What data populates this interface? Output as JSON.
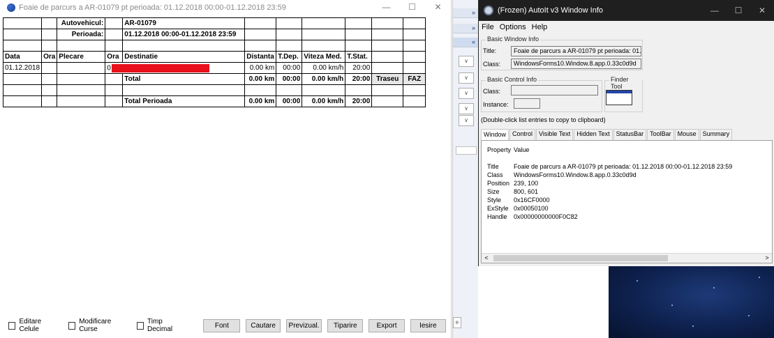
{
  "report_window": {
    "title": "Foaie de parcurs a AR-01079 pt perioada: 01.12.2018 00:00-01.12.2018 23:59",
    "controls": {
      "minimize": "—",
      "maximize": "☐",
      "close": "✕"
    },
    "header": {
      "vehicle_label": "Autovehicul:",
      "vehicle_value": "AR-01079",
      "period_label": "Perioada:",
      "period_value": "01.12.2018 00:00-01.12.2018 23:59"
    },
    "columns": [
      "Data",
      "Ora",
      "Plecare",
      "Ora",
      "Destinatie",
      "Distanta",
      "T.Dep.",
      "Viteza Med.",
      "T.Stat."
    ],
    "row": {
      "data": "01.12.2018",
      "ora_prefix": "0",
      "distanta": "0.00 km",
      "t_dep": "00:00",
      "viteza": "0.00 km/h",
      "t_stat": "20:00"
    },
    "total": {
      "label": "Total",
      "distanta": "0.00 km",
      "t_dep": "00:00",
      "viteza": "0.00 km/h",
      "t_stat": "20:00",
      "traseu_label": "Traseu",
      "faz_label": "FAZ"
    },
    "total_period": {
      "label": "Total Perioada",
      "distanta": "0.00 km",
      "t_dep": "00:00",
      "viteza": "0.00 km/h",
      "t_stat": "20:00"
    },
    "bottom": {
      "checkboxes": [
        "Editare Celule",
        "Modificare Curse",
        "Timp Decimal"
      ],
      "buttons": [
        "Font",
        "Cautare",
        "Previzual.",
        "Tiparire",
        "Export",
        "Iesire"
      ]
    }
  },
  "middle_strip": {
    "chevrons": [
      "»",
      "»",
      "«"
    ],
    "dropdown_glyph": "∨",
    "edge_button": "e"
  },
  "autoit": {
    "title": "(Frozen) AutoIt v3 Window Info",
    "controls": {
      "minimize": "—",
      "maximize": "☐",
      "close": "✕"
    },
    "menu": [
      "File",
      "Options",
      "Help"
    ],
    "basic_window_info": {
      "group_label": "Basic Window Info",
      "title_label": "Title:",
      "title_value": "Foaie de parcurs a AR-01079 pt perioada: 01.",
      "class_label": "Class:",
      "class_value": "WindowsForms10.Window.8.app.0.33c0d9d"
    },
    "basic_control_info": {
      "group_label": "Basic Control Info",
      "class_label": "Class:",
      "instance_label": "Instance:"
    },
    "finder_label": "Finder Tool",
    "hint": "(Double-click list entries to copy to clipboard)",
    "tabs": [
      "Window",
      "Control",
      "Visible Text",
      "Hidden Text",
      "StatusBar",
      "ToolBar",
      "Mouse",
      "Summary"
    ],
    "active_tab": "Window",
    "props_header": {
      "property": "Property",
      "value": "Value"
    },
    "props": [
      {
        "k": "Title",
        "v": "Foaie de parcurs a AR-01079 pt perioada: 01.12.2018 00:00-01.12.2018 23:59"
      },
      {
        "k": "Class",
        "v": "WindowsForms10.Window.8.app.0.33c0d9d"
      },
      {
        "k": "Position",
        "v": "239, 100"
      },
      {
        "k": "Size",
        "v": "800, 601"
      },
      {
        "k": "Style",
        "v": "0x16CF0000"
      },
      {
        "k": "ExStyle",
        "v": "0x00050100"
      },
      {
        "k": "Handle",
        "v": "0x00000000000F0C82"
      }
    ],
    "scroll": {
      "left": "<",
      "right": ">"
    }
  },
  "colors": {
    "redaction": "#e8101b",
    "autoit_titlebar": "#1f1f1f",
    "desktop": "#0e214e"
  }
}
